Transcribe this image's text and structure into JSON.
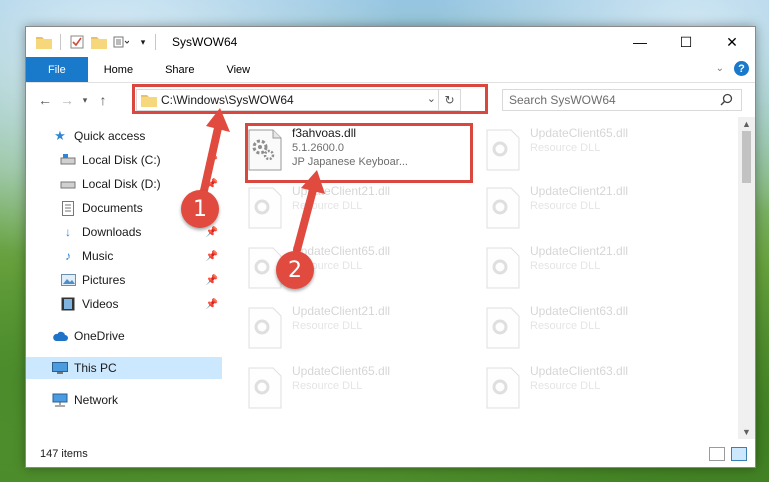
{
  "window": {
    "title": "SysWOW64",
    "controls": {
      "minimize": "—",
      "maximize": "☐",
      "close": "✕"
    }
  },
  "ribbon": {
    "tabs": [
      "File",
      "Home",
      "Share",
      "View"
    ],
    "help": "?"
  },
  "address": {
    "path": "C:\\Windows\\SysWOW64",
    "search_placeholder": "Search SysWOW64"
  },
  "sidebar": {
    "items": [
      {
        "label": "Quick access",
        "icon": "star-icon"
      },
      {
        "label": "Local Disk (C:)",
        "icon": "drive-icon"
      },
      {
        "label": "Local Disk (D:)",
        "icon": "drive-icon"
      },
      {
        "label": "Documents",
        "icon": "document-icon"
      },
      {
        "label": "Downloads",
        "icon": "download-icon"
      },
      {
        "label": "Music",
        "icon": "music-icon"
      },
      {
        "label": "Pictures",
        "icon": "pictures-icon"
      },
      {
        "label": "Videos",
        "icon": "videos-icon"
      },
      {
        "label": "OneDrive",
        "icon": "cloud-icon"
      },
      {
        "label": "This PC",
        "icon": "pc-icon"
      },
      {
        "label": "Network",
        "icon": "network-icon"
      }
    ]
  },
  "files": [
    {
      "name": "f3ahvoas.dll",
      "line1": "5.1.2600.0",
      "line2": "JP Japanese Keyboar..."
    },
    {
      "name": "UpdateClient65.dll",
      "line1": "Resource DLL"
    },
    {
      "name": "UpdateClient21.dll",
      "line1": "Resource DLL"
    },
    {
      "name": "UpdateClient21.dll",
      "line1": "Resource DLL"
    },
    {
      "name": "UpdateClient65.dll",
      "line1": "Resource DLL"
    },
    {
      "name": "UpdateClient21.dll",
      "line1": "Resource DLL"
    },
    {
      "name": "UpdateClient21.dll",
      "line1": "Resource DLL"
    },
    {
      "name": "UpdateClient63.dll",
      "line1": "Resource DLL"
    },
    {
      "name": "UpdateClient65.dll",
      "line1": "Resource DLL"
    },
    {
      "name": "UpdateClient63.dll",
      "line1": "Resource DLL"
    }
  ],
  "status": {
    "count": "147 items"
  },
  "annotations": {
    "step1": "1",
    "step2": "2",
    "color": "#d9473f"
  }
}
